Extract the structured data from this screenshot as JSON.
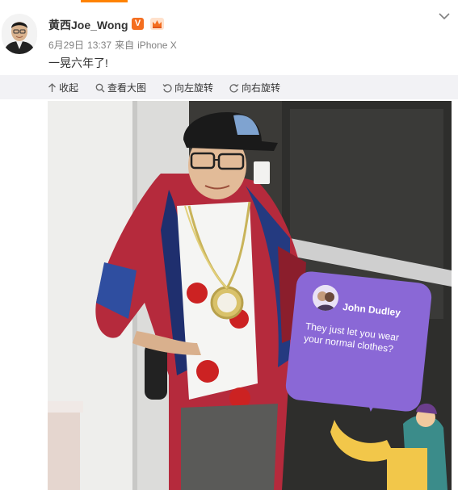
{
  "post": {
    "username": "黄西Joe_Wong",
    "verified_label": "V",
    "date": "6月29日",
    "time": "13:37",
    "source_prefix": "来自",
    "source": "iPhone X",
    "text": "一晃六年了!"
  },
  "toolbar": {
    "collapse_label": "收起",
    "view_large_label": "查看大图",
    "rotate_left_label": "向左旋转",
    "rotate_right_label": "向右旋转"
  },
  "photo_overlay": {
    "name": "John Dudley",
    "message": "They just let you wear your normal clothes?"
  },
  "icons": [
    "collapse-arrow-icon",
    "search-icon",
    "rotate-left-icon",
    "rotate-right-icon",
    "chevron-down-icon",
    "vip-crown-icon"
  ],
  "colors": {
    "accent": "#ff8200",
    "verified": "#f46e20",
    "toolbar_bg": "#f2f2f5",
    "bubble": "#8a68d6"
  }
}
